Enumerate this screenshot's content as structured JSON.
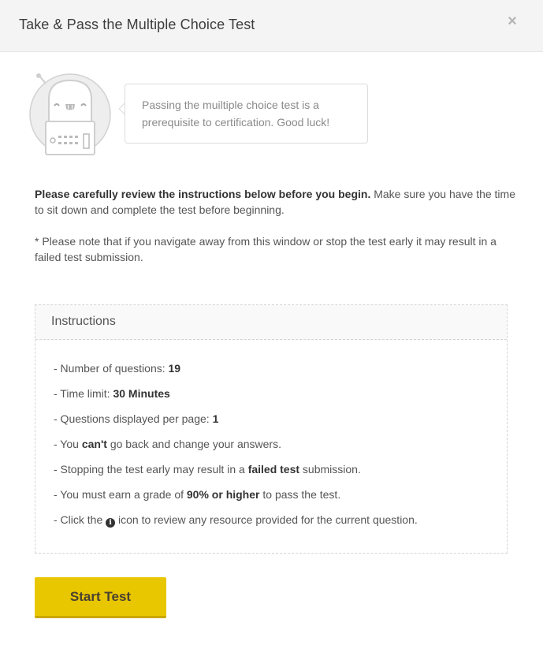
{
  "modal": {
    "title": "Take & Pass the Multiple Choice Test",
    "close_label": "×"
  },
  "robot": {
    "bubble_text": "Passing the muiltiple choice test is a prerequisite to certification. Good luck!"
  },
  "intro": {
    "bold": "Please carefully review the instructions below before you begin.",
    "rest": " Make sure you have the time to sit down and complete the test before beginning.",
    "note": "* Please note that if you navigate away from this window or stop the test early it may result in a failed test submission."
  },
  "instructions": {
    "title": "Instructions",
    "items": [
      {
        "pre": "- Number of questions: ",
        "bold": "19",
        "post": ""
      },
      {
        "pre": "- Time limit: ",
        "bold": "30 Minutes",
        "post": ""
      },
      {
        "pre": "- Questions displayed per page: ",
        "bold": "1",
        "post": ""
      },
      {
        "pre": "- You ",
        "bold": "can't",
        "post": " go back and change your answers."
      },
      {
        "pre": "- Stopping the test early may result in a ",
        "bold": "failed test",
        "post": " submission."
      },
      {
        "pre": "- You must earn a grade of ",
        "bold": "90% or higher",
        "post": " to pass the test."
      },
      {
        "pre": "- Click the ",
        "icon": "info-icon",
        "post": " icon to review any resource provided for the current question."
      }
    ]
  },
  "actions": {
    "start_label": "Start Test"
  },
  "colors": {
    "accent": "#e8c600",
    "header_bg": "#f4f4f4"
  }
}
